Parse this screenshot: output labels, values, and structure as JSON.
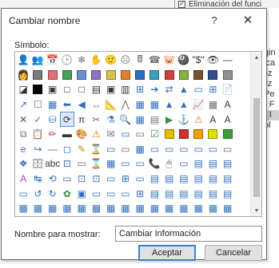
{
  "background": {
    "top_text": "Eliminación del funci",
    "top_checkbox": "✓",
    "right_lines": [
      "gin",
      "ica",
      "liz",
      "liz",
      "Pe",
      "r F",
      "r I",
      "ol"
    ]
  },
  "dialog": {
    "title": "Cambiar nombre",
    "help_button": "?",
    "close_button": "✕",
    "symbol_label": "Símbolo:",
    "name_label": "Nombre para mostrar:",
    "name_value": "Cambiar Información",
    "ok_label": "Aceptar",
    "cancel_label": "Cancelar"
  },
  "symbols": [
    [
      "👤",
      "👥",
      "📅",
      "🕒",
      "❄",
      "✋",
      "🙂",
      "☹",
      "🖩",
      "☎",
      "🐷",
      "🎱",
      "\"$\"",
      "👁",
      "—",
      ""
    ],
    [
      "👩",
      "■",
      "■",
      "■",
      "■",
      "■",
      "■",
      "■",
      "■",
      "■",
      "■",
      "■",
      "■",
      "■",
      "■",
      ""
    ],
    [
      "◪",
      "■",
      "▣",
      "□",
      "□",
      "▤",
      "▣",
      "▥",
      "⊞",
      "➔",
      "⇄",
      "▲",
      "▭",
      "⊞",
      "📄",
      ""
    ],
    [
      "↗",
      "☐",
      "▦",
      "⬅",
      "◀",
      "↔",
      "📐",
      "⋀",
      "▦",
      "▦",
      "▲",
      "▲",
      "📈",
      "▦",
      "A",
      ""
    ],
    [
      "✕",
      "✓",
      "⛁",
      "⟳",
      "π",
      "✂",
      "⚗",
      "🔍",
      "▦",
      "▤",
      "▶",
      "⚓",
      "⚠",
      "A",
      "A",
      ""
    ],
    [
      "⧉",
      "📋",
      "✏",
      "▬",
      "🎨",
      "⚠",
      "✉",
      "▭",
      "▭",
      "☑",
      "■",
      "■",
      "■",
      "■",
      "■",
      ""
    ],
    [
      "e",
      "↪",
      "—",
      "◻",
      "✎",
      "⌛",
      "▭",
      "▭",
      "▦",
      "▭",
      "▭",
      "▭",
      "▭",
      "▭",
      "▭",
      ""
    ],
    [
      "❖",
      "🗄",
      "abc",
      "⊡",
      "▭",
      "⌛",
      "▦",
      "▭",
      "▭",
      "📞",
      "🖱",
      "▭",
      "▤",
      "▤",
      "▤",
      ""
    ],
    [
      "A",
      "↹",
      "⟲",
      "▭",
      "⊡",
      "⊡",
      "▭",
      "⊞",
      "▭",
      "▤",
      "▤",
      "▤",
      "▤",
      "▤",
      "▤",
      ""
    ],
    [
      "▭",
      "↺",
      "↻",
      "✿",
      "▣",
      "▭",
      "▭",
      "▭",
      "⊞",
      "▤",
      "▤",
      "▤",
      "▤",
      "▤",
      "▤",
      ""
    ],
    [
      "▦",
      "▦",
      "▦",
      "▦",
      "▦",
      "▦",
      "▦",
      "▦",
      "▦",
      "▦",
      "▦",
      "▦",
      "▦",
      "▦",
      "▦",
      ""
    ]
  ],
  "symbol_colors": [
    [
      "#c25a1a",
      "#6e6e6e",
      "#3c6ea6",
      "#3c6ea6",
      "#6e6e6e",
      "#6e6e6e",
      "#e2b400",
      "#6e6e6e",
      "#6e6e6e",
      "#6e6e6e",
      "#6e6e6e",
      "#333333",
      "#333333",
      "#333333",
      "#333333",
      "#ffffff"
    ],
    [
      "#444444",
      "#7b7b7b",
      "#e07070",
      "#4aa05a",
      "#6a8fd0",
      "#9370c0",
      "#d8c050",
      "#e08030",
      "#2f6fbf",
      "#3aa0c0",
      "#d04040",
      "#8ab040",
      "#7a5030",
      "#2f4f8f",
      "#8f8f8f",
      "#ffffff"
    ],
    [
      "#333333",
      "#000000",
      "#333333",
      "#333333",
      "#333333",
      "#333333",
      "#333333",
      "#333333",
      "#2f6fbf",
      "#2f6fbf",
      "#2f6fbf",
      "#2f6fbf",
      "#2f6fbf",
      "#2f6fbf",
      "#6e6e6e",
      "#ffffff"
    ],
    [
      "#2f6fbf",
      "#6e6e6e",
      "#2f6fbf",
      "#2f6fbf",
      "#2f6fbf",
      "#6e6e6e",
      "#2f6fbf",
      "#6e6e6e",
      "#2f6fbf",
      "#2f6fbf",
      "#2f6fbf",
      "#2f6fbf",
      "#2f6fbf",
      "#6e6e6e",
      "#333333",
      "#ffffff"
    ],
    [
      "#555555",
      "#3a8f3a",
      "#2f6fbf",
      "#333333",
      "#333333",
      "#6e6e6e",
      "#2f6fbf",
      "#6e6e6e",
      "#2f6fbf",
      "#6e6e6e",
      "#3a8f3a",
      "#555555",
      "#d08000",
      "#333333",
      "#333333",
      "#ffffff"
    ],
    [
      "#6e6e6e",
      "#6e6e6e",
      "#c04040",
      "#333333",
      "#c04040",
      "#d08000",
      "#6e6e6e",
      "#2f6fbf",
      "#6e6e6e",
      "#3a8f3a",
      "#e0c000",
      "#d03030",
      "#f0a000",
      "#e0e000",
      "#3a9f3a",
      "#ffffff"
    ],
    [
      "#2f6fbf",
      "#2f6fbf",
      "#6e6e6e",
      "#2f6fbf",
      "#d08000",
      "#6e6e6e",
      "#2f6fbf",
      "#6e6e6e",
      "#2f6fbf",
      "#2f6fbf",
      "#2f6fbf",
      "#2f6fbf",
      "#2f6fbf",
      "#2f6fbf",
      "#6e6e6e",
      "#ffffff"
    ],
    [
      "#2f6fbf",
      "#6e6e6e",
      "#333333",
      "#2f6fbf",
      "#6e6e6e",
      "#6e6e6e",
      "#2f6fbf",
      "#2f6fbf",
      "#2f6fbf",
      "#333333",
      "#6e6e6e",
      "#2f6fbf",
      "#2f6fbf",
      "#2f6fbf",
      "#2f6fbf",
      "#ffffff"
    ],
    [
      "#9c4fb0",
      "#2f6fbf",
      "#2f6fbf",
      "#2f6fbf",
      "#2f6fbf",
      "#2f6fbf",
      "#2f6fbf",
      "#2f6fbf",
      "#2f6fbf",
      "#2f6fbf",
      "#2f6fbf",
      "#2f6fbf",
      "#2f6fbf",
      "#2f6fbf",
      "#2f6fbf",
      "#ffffff"
    ],
    [
      "#2f6fbf",
      "#2f6fbf",
      "#2f6fbf",
      "#3a8f3a",
      "#2f6fbf",
      "#2f6fbf",
      "#2f6fbf",
      "#2f6fbf",
      "#2f6fbf",
      "#2f6fbf",
      "#2f6fbf",
      "#2f6fbf",
      "#2f6fbf",
      "#2f6fbf",
      "#2f6fbf",
      "#ffffff"
    ],
    [
      "#2f6fbf",
      "#2f6fbf",
      "#2f6fbf",
      "#2f6fbf",
      "#2f6fbf",
      "#2f6fbf",
      "#2f6fbf",
      "#2f6fbf",
      "#2f6fbf",
      "#2f6fbf",
      "#2f6fbf",
      "#2f6fbf",
      "#2f6fbf",
      "#2f6fbf",
      "#2f6fbf",
      "#ffffff"
    ]
  ],
  "selected_cell": [
    4,
    3
  ]
}
